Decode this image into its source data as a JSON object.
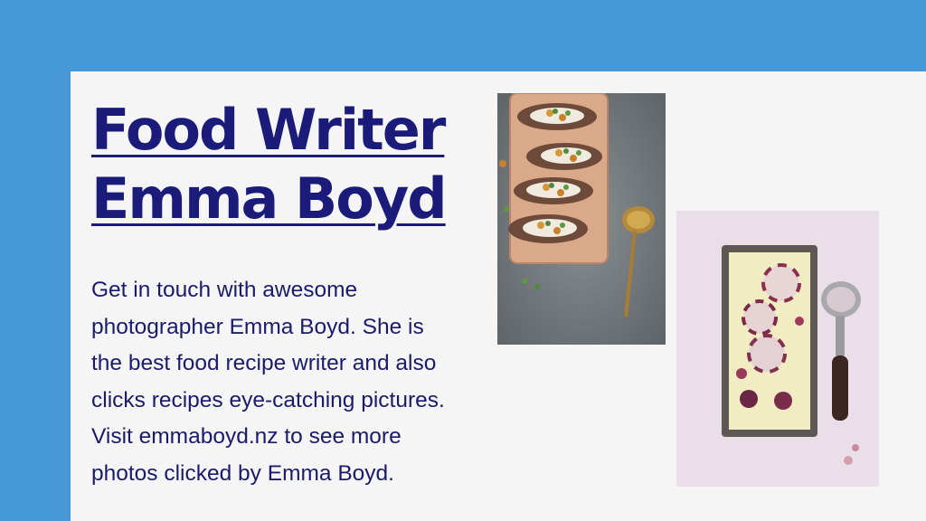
{
  "title": {
    "line1": "Food Writer",
    "line2": "Emma Boyd"
  },
  "description": {
    "lines": [
      "Get in touch with awesome",
      "photographer Emma Boyd. She is",
      "the best food recipe writer and also",
      "clicks recipes eye-catching pictures.",
      "Visit emmaboyd.nz to see more",
      "photos clicked by Emma Boyd."
    ]
  },
  "colors": {
    "frame": "#4699d6",
    "card": "#f5f5f5",
    "title": "#1b1b7a",
    "text": "#1b1b6e"
  }
}
